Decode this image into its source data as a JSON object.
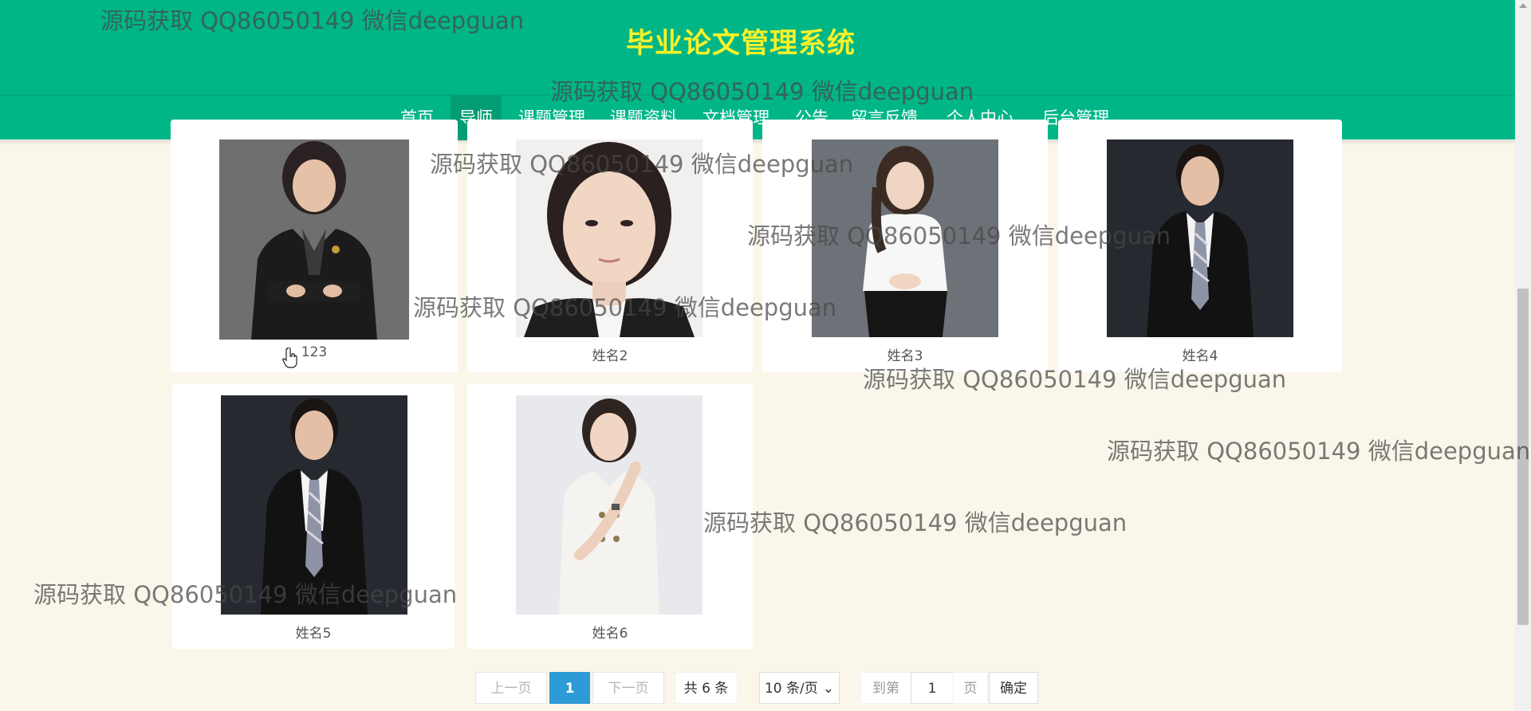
{
  "header": {
    "title": "毕业论文管理系统"
  },
  "nav": {
    "items": [
      {
        "label": "首页"
      },
      {
        "label": "导师"
      },
      {
        "label": "课题管理"
      },
      {
        "label": "课题资料"
      },
      {
        "label": "文档管理"
      },
      {
        "label": "公告"
      },
      {
        "label": "留言反馈"
      },
      {
        "label": "个人中心"
      },
      {
        "label": "后台管理"
      }
    ],
    "active_index": 1
  },
  "mentors": [
    {
      "name": "123"
    },
    {
      "name": "姓名2"
    },
    {
      "name": "姓名3"
    },
    {
      "name": "姓名4"
    },
    {
      "name": "姓名5"
    },
    {
      "name": "姓名6"
    }
  ],
  "pagination": {
    "prev_label": "上一页",
    "current_page": "1",
    "next_label": "下一页",
    "total_label": "共 6 条",
    "page_size_label": "10 条/页",
    "goto_label": "到第",
    "goto_value": "1",
    "page_suffix": "页",
    "confirm_label": "确定"
  },
  "watermark_text": "源码获取 QQ86050149 微信deepguan",
  "colors": {
    "header_bg": "#00b687",
    "nav_active_bg": "#049d73",
    "title_color": "#f7f12a",
    "page_bg": "#faf6ea",
    "pagination_active": "#2d9bd6"
  }
}
